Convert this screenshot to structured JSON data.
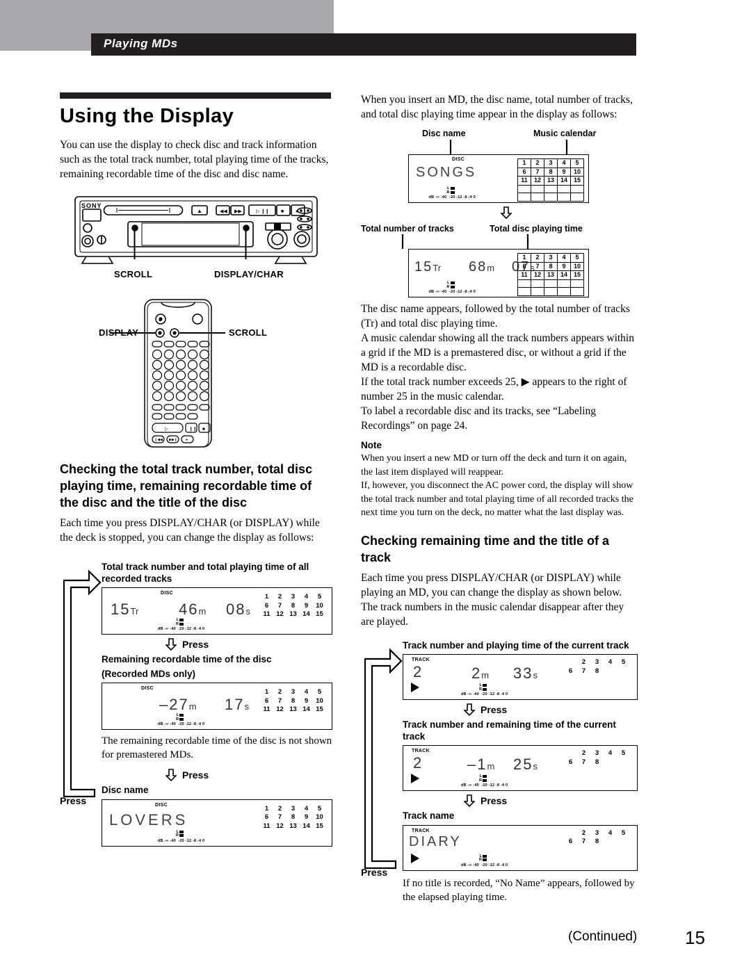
{
  "header": {
    "section_title": "Playing MDs"
  },
  "left": {
    "h1": "Using the Display",
    "intro": "You can use the display to check disc and track information such as the total track number, total playing time of the tracks, remaining recordable time of the disc and disc name.",
    "deck_labels": {
      "scroll": "SCROLL",
      "display_char": "DISPLAY/CHAR",
      "brand": "SONY"
    },
    "remote_labels": {
      "display": "DISPLAY",
      "scroll": "SCROLL"
    },
    "h2": "Checking the total track number, total disc playing time, remaining recordable time of the disc and the title of the disc",
    "para": "Each time you press DISPLAY/CHAR (or DISPLAY) while the deck is stopped, you can change the display as follows:",
    "press_label": "Press",
    "steps": [
      {
        "caption": "Total track number and total playing time of all recorded tracks",
        "mode": "DISC",
        "value1": "15",
        "unit1": "Tr",
        "value2": "46",
        "unit2": "m",
        "value3": "08",
        "unit3": "s",
        "calendar_rows": [
          [
            "1",
            "2",
            "3",
            "4",
            "5"
          ],
          [
            "6",
            "7",
            "8",
            "9",
            "10"
          ],
          [
            "11",
            "12",
            "13",
            "14",
            "15"
          ]
        ]
      },
      {
        "caption": "Remaining recordable time of the disc",
        "caption2": "(Recorded MDs only)",
        "mode": "DISC",
        "value1": "",
        "unit1": "",
        "value2": "–27",
        "unit2": "m",
        "value3": "17",
        "unit3": "s",
        "calendar_rows": [
          [
            "1",
            "2",
            "3",
            "4",
            "5"
          ],
          [
            "6",
            "7",
            "8",
            "9",
            "10"
          ],
          [
            "11",
            "12",
            "13",
            "14",
            "15"
          ]
        ],
        "note_after": "The remaining recordable time of the disc is not shown for premastered MDs."
      },
      {
        "caption": "Disc name",
        "mode": "DISC",
        "name": "LOVERS",
        "calendar_rows": [
          [
            "1",
            "2",
            "3",
            "4",
            "5"
          ],
          [
            "6",
            "7",
            "8",
            "9",
            "10"
          ],
          [
            "11",
            "12",
            "13",
            "14",
            "15"
          ]
        ]
      }
    ]
  },
  "right": {
    "intro": "When you insert an MD, the disc name, total number of tracks, and total disc playing time appear in the display as follows:",
    "callouts": {
      "disc_name": "Disc name",
      "music_calendar": "Music calendar",
      "total_tracks": "Total number of tracks",
      "total_time": "Total disc playing time"
    },
    "display_songs": {
      "mode": "DISC",
      "name": "SONGS",
      "calendar_rows": [
        [
          "1",
          "2",
          "3",
          "4",
          "5"
        ],
        [
          "6",
          "7",
          "8",
          "9",
          "10"
        ],
        [
          "11",
          "12",
          "13",
          "14",
          "15"
        ],
        [
          "",
          "",
          "",
          "",
          ""
        ],
        [
          "",
          "",
          "",
          "",
          ""
        ]
      ]
    },
    "display_total": {
      "mode": "DISC",
      "value1": "15",
      "unit1": "Tr",
      "value2": "68",
      "unit2": "m",
      "value3": "07",
      "unit3": "s",
      "calendar_rows": [
        [
          "1",
          "2",
          "3",
          "4",
          "5"
        ],
        [
          "6",
          "7",
          "8",
          "9",
          "10"
        ],
        [
          "11",
          "12",
          "13",
          "14",
          "15"
        ],
        [
          "",
          "",
          "",
          "",
          ""
        ],
        [
          "",
          "",
          "",
          "",
          ""
        ]
      ]
    },
    "body": "The disc name appears, followed by the total number of tracks (Tr) and total disc playing time.\nA music calendar showing all the track numbers appears within a grid if the MD is a premastered disc, or without a grid if the MD is a recordable disc.\nIf the total track number exceeds 25, ▶ appears to the right of number 25 in the music calendar.\nTo label a recordable disc and its tracks, see “Labeling Recordings” on page 24.",
    "note_heading": "Note",
    "note": "When you insert a new MD or turn off the deck and turn it on again, the last item displayed will reappear.\nIf, however, you disconnect the AC power cord, the display will show the total track number and total playing time of all recorded tracks the next time you turn on the deck, no matter what the last display was.",
    "h2": "Checking remaining time and the title of a track",
    "para": "Each time you press DISPLAY/CHAR (or DISPLAY) while playing an MD, you can change the display as shown below.  The track numbers in the music calendar disappear after they are played.",
    "press_label": "Press",
    "steps": [
      {
        "caption": "Track number and playing time of the current track",
        "mode": "TRACK",
        "value1": "2",
        "unit1": "",
        "value2": "2",
        "unit2": "m",
        "value3": "33",
        "unit3": "s",
        "calendar_rows": [
          [
            "",
            "2",
            "3",
            "4",
            "5"
          ],
          [
            "6",
            "7",
            "8",
            "",
            ""
          ]
        ]
      },
      {
        "caption": "Track number and remaining time of the current track",
        "mode": "TRACK",
        "value1": "2",
        "unit1": "",
        "value2": "–1",
        "unit2": "m",
        "value3": "25",
        "unit3": "s",
        "calendar_rows": [
          [
            "",
            "2",
            "3",
            "4",
            "5"
          ],
          [
            "6",
            "7",
            "8",
            "",
            ""
          ]
        ]
      },
      {
        "caption": "Track name",
        "mode": "TRACK",
        "name": "DIARY",
        "calendar_rows": [
          [
            "",
            "2",
            "3",
            "4",
            "5"
          ],
          [
            "6",
            "7",
            "8",
            "",
            ""
          ]
        ]
      }
    ],
    "closing": "If no title is recorded, “No Name” appears, followed by the elapsed playing time."
  },
  "meter": {
    "left_label": "L",
    "right_label": "R",
    "db_label": "dB",
    "scale": [
      "-∞",
      "-40",
      "-20",
      "-12",
      "-8",
      "-4",
      "0"
    ]
  },
  "footer": {
    "continued": "(Continued)",
    "page_number": "15"
  }
}
